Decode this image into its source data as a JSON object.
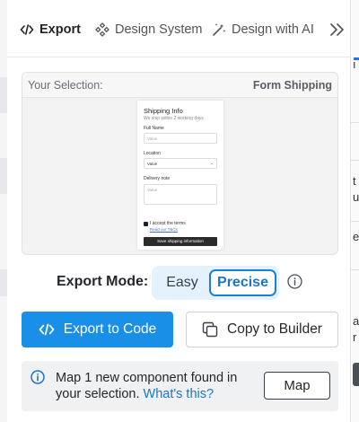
{
  "tabs": [
    {
      "label": "Export",
      "icon": "code-icon",
      "active": true
    },
    {
      "label": "Design System",
      "icon": "components-icon",
      "active": false
    },
    {
      "label": "Design with AI",
      "icon": "magic-wand-icon",
      "active": false
    }
  ],
  "more_icon": "chevrons-right-icon",
  "selection": {
    "label": "Your Selection:",
    "name": "Form Shipping"
  },
  "form_preview": {
    "title": "Shipping Info",
    "subtitle": "We ship within 2 working days",
    "full_name_label": "Full Name",
    "full_name_placeholder": "Value",
    "location_label": "Location",
    "location_value": "Value",
    "delivery_label": "Delivery note",
    "delivery_placeholder": "Value",
    "checkbox_label": "I accept the terms",
    "terms_link": "Read our T&Cs",
    "submit_label": "Save shipping information"
  },
  "export_mode": {
    "label": "Export Mode:",
    "options": [
      "Easy",
      "Precise"
    ],
    "selected": "Precise"
  },
  "actions": {
    "export_label": "Export to Code",
    "copy_label": "Copy to Builder"
  },
  "notice": {
    "message": "Map 1 new component found in your selection.",
    "link": "What's this?",
    "button": "Map"
  },
  "colors": {
    "accent": "#1a8fe8",
    "link": "#1a76c9",
    "segment_bg": "#e4f2fd"
  }
}
